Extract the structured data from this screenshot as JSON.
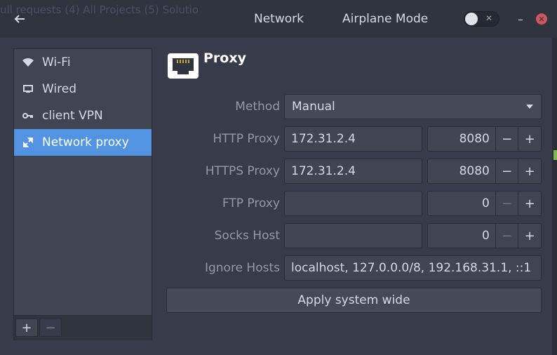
{
  "titlebar": {
    "background_ghost_text": "ull requests (4)      All Projects (5)                          Solutio",
    "title": "Network",
    "airplane_label": "Airplane Mode",
    "airplane_enabled": false,
    "toggle_off_glyph": "✕",
    "minimize_glyph": "–",
    "close_glyph": "✕"
  },
  "sidebar": {
    "items": [
      {
        "label": "Wi-Fi",
        "icon": "wifi-icon"
      },
      {
        "label": "Wired",
        "icon": "wired-icon"
      },
      {
        "label": "client VPN",
        "icon": "vpn-key-icon"
      },
      {
        "label": "Network proxy",
        "icon": "network-proxy-icon",
        "selected": true
      }
    ],
    "add_label": "+",
    "remove_label": "−"
  },
  "page": {
    "title": "Proxy",
    "icon": "ethernet-port-icon"
  },
  "form": {
    "method_label": "Method",
    "method_value": "Manual",
    "rows": [
      {
        "label": "HTTP Proxy",
        "host": "172.31.2.4",
        "port": "8080"
      },
      {
        "label": "HTTPS Proxy",
        "host": "172.31.2.4",
        "port": "8080"
      },
      {
        "label": "FTP Proxy",
        "host": "",
        "port": "0"
      },
      {
        "label": "Socks Host",
        "host": "",
        "port": "0"
      }
    ],
    "ignore_label": "Ignore Hosts",
    "ignore_value": "localhost, 127.0.0.0/8, 192.168.31.1, ::1",
    "minus_glyph": "−",
    "plus_glyph": "+",
    "apply_label": "Apply system wide"
  },
  "colors": {
    "accent": "#5294e2",
    "window_bg": "#383c4a",
    "titlebar_bg": "#2f343f",
    "field_bg": "#404552",
    "close": "#cc575d"
  }
}
